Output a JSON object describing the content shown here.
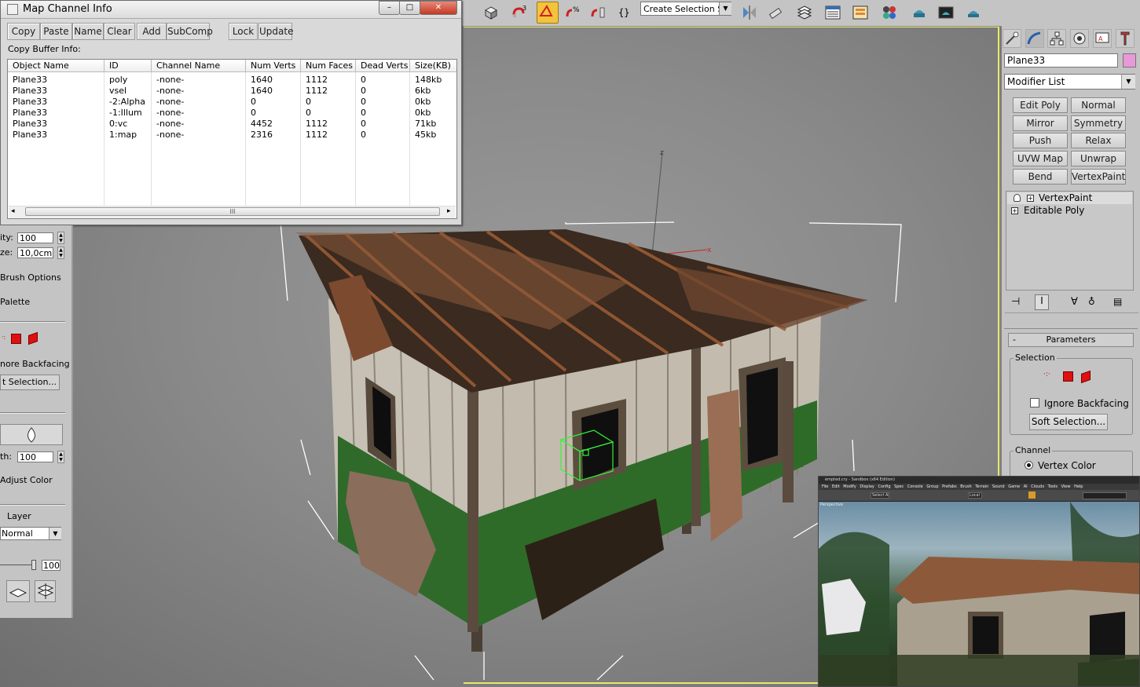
{
  "dialog": {
    "title": "Map Channel Info",
    "buttons": [
      "Copy",
      "Paste",
      "Name",
      "Clear",
      "Add",
      "SubComp",
      "Lock",
      "Update"
    ],
    "copy_buffer_label": "Copy Buffer Info:",
    "window_controls": {
      "minimize": "–",
      "maximize": "□",
      "close": "✕"
    },
    "columns": [
      "Object Name",
      "ID",
      "Channel Name",
      "Num Verts",
      "Num Faces",
      "Dead Verts",
      "Size(KB)"
    ],
    "rows": [
      [
        "Plane33",
        "poly",
        "-none-",
        "1640",
        "1112",
        "0",
        "148kb"
      ],
      [
        "Plane33",
        "vsel",
        "-none-",
        "1640",
        "1112",
        "0",
        "6kb"
      ],
      [
        "Plane33",
        "-2:Alpha",
        "-none-",
        "0",
        "0",
        "0",
        "0kb"
      ],
      [
        "Plane33",
        "-1:Illum",
        "-none-",
        "0",
        "0",
        "0",
        "0kb"
      ],
      [
        "Plane33",
        "0:vc",
        "-none-",
        "4452",
        "1112",
        "0",
        "71kb"
      ],
      [
        "Plane33",
        "1:map",
        "-none-",
        "2316",
        "1112",
        "0",
        "45kb"
      ]
    ],
    "scroll_grip": "III"
  },
  "toolbar": {
    "selection_set_placeholder": "Create Selection Set",
    "icons": [
      "teapot-box-icon",
      "snap-3-icon",
      "angle-snap-icon",
      "percent-snap-icon",
      "spinner-snap-icon",
      "edit-named-sets-icon",
      "mirror-icon",
      "align-icon",
      "layers-icon",
      "graphite-ribbon-icon",
      "curve-editor-icon",
      "material-editor-icon",
      "render-setup-icon",
      "rendered-frame-icon",
      "render-teapot-icon"
    ],
    "snap_label": "3"
  },
  "left_panel": {
    "opacity_label": "ity:",
    "opacity_value": "100",
    "size_label": "ze:",
    "size_value": "10,0cm",
    "brush_options": "Brush Options",
    "palette": "Palette",
    "ignore_backfacing": "nore Backfacing",
    "soft_selection": "t Selection...",
    "strength_label": "th:",
    "strength_value": "100",
    "adjust_color": "Adjust Color",
    "layer_label": "Layer",
    "layer_mode": "Normal",
    "slider_value": "100"
  },
  "command_panel": {
    "object_name": "Plane33",
    "object_color": "#e799d8",
    "modifier_list": "Modifier List",
    "modifier_buttons": [
      "Edit Poly",
      "Normal",
      "Mirror",
      "Symmetry",
      "Push",
      "Relax",
      "UVW Map",
      "Unwrap UVW",
      "Bend",
      "VertexPaint"
    ],
    "stack": [
      "VertexPaint",
      "Editable Poly"
    ],
    "parameters_title": "Parameters",
    "parameters_collapse": "-",
    "selection_group": "Selection",
    "ignore_backfacing": "Ignore Backfacing",
    "soft_selection": "Soft Selection...",
    "channel_group": "Channel",
    "vertex_color": "Vertex Color"
  },
  "viewport": {
    "axis_label": "z",
    "x_label": "x"
  },
  "insert": {
    "title": "empted.cry - Sandbox (x64 Edition)",
    "menu": [
      "File",
      "Edit",
      "Modify",
      "Display",
      "Config Spec",
      "Console",
      "Group",
      "Prefabs",
      "Brush",
      "Terrain",
      "Sound",
      "Game",
      "AI",
      "Clouds",
      "Tools",
      "View",
      "Help"
    ],
    "viewport_label": "Perspective",
    "select_all": "Select All",
    "coord_mode": "Local"
  }
}
